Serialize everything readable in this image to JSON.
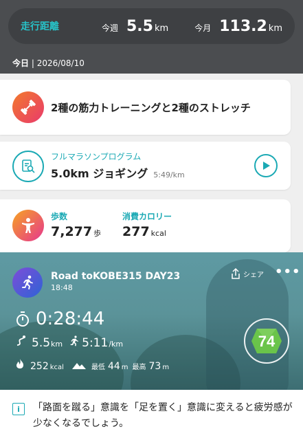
{
  "header": {
    "distance_label": "走行距離",
    "week_label": "今週",
    "week_value": "5.5",
    "week_unit": "km",
    "month_label": "今月",
    "month_value": "113.2",
    "month_unit": "km",
    "today_label": "今日",
    "today_date": " | 2026/08/10"
  },
  "training_card": {
    "icon": "dumbbell-icon",
    "title": "2種の筋力トレーニングと2種のストレッチ"
  },
  "program_card": {
    "icon": "clipboard-search-icon",
    "subtitle": "フルマラソンプログラム",
    "workout": "5.0km ジョギング",
    "pace": "5:49/km",
    "play_icon": "play-icon"
  },
  "stats_card": {
    "icon": "person-icon",
    "steps_label": "歩数",
    "steps_value": "7,277",
    "steps_unit": "歩",
    "calories_label": "消費カロリー",
    "calories_value": "277",
    "calories_unit": "kcal"
  },
  "activity": {
    "title": "Road toKOBE315 DAY23",
    "time": "18:48",
    "share_label": "シェア",
    "more_label": "•••",
    "duration": "0:28:44",
    "distance_value": "5.5",
    "distance_unit": "km",
    "pace_value": "5:11",
    "pace_unit": "/km",
    "calories_value": "252",
    "calories_unit": "kcal",
    "min_label": "最低",
    "min_value": "44",
    "min_unit": "m",
    "max_label": "最高",
    "max_value": "73",
    "max_unit": "m",
    "score": "74"
  },
  "tip": {
    "icon_glyph": "i",
    "text": "「路面を蹴る」意識を「足を置く」意識に変えると疲労感が少なくなるでしょう。"
  },
  "colors": {
    "accent": "#1aa9b4",
    "header_bg": "#4b4d50",
    "score_green": "#6ac44a"
  }
}
